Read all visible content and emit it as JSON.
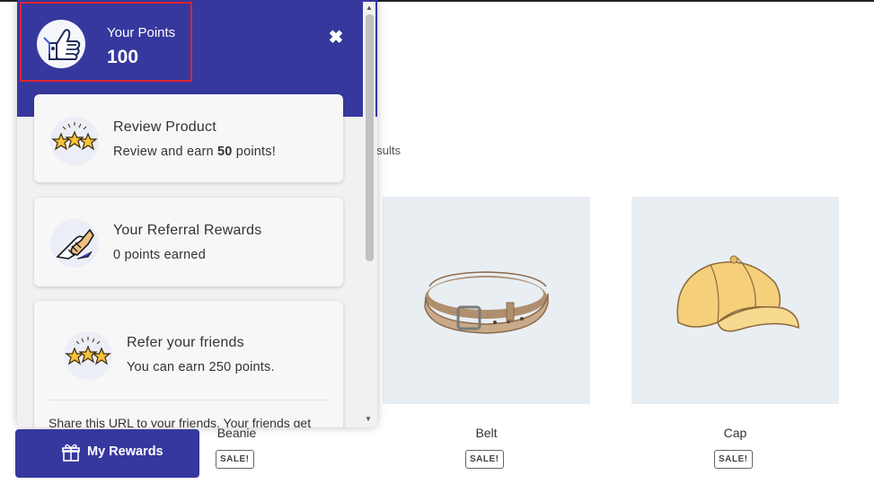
{
  "shop": {
    "results_text": "esults",
    "products": [
      {
        "name": "Beanie",
        "badge": "SALE!"
      },
      {
        "name": "Belt",
        "badge": "SALE!"
      },
      {
        "name": "Cap",
        "badge": "SALE!"
      }
    ]
  },
  "rewards_panel": {
    "points_label": "Your Points",
    "points_value": "100",
    "close_icon": "close-icon",
    "cards": [
      {
        "icon": "stars-icon",
        "title": "Review Product",
        "sub_prefix": "Review and earn ",
        "sub_bold": "50",
        "sub_suffix": " points!"
      },
      {
        "icon": "handshake-icon",
        "title": "Your Referral Rewards",
        "sub": "0 points earned"
      },
      {
        "icon": "stars-icon",
        "title": "Refer your friends",
        "sub": "You can earn 250 points.",
        "share_text": "Share this URL to your friends. Your friends get"
      }
    ]
  },
  "my_rewards_button": {
    "label": "My Rewards",
    "icon": "gift-icon"
  },
  "colors": {
    "brand": "#36389e",
    "highlight": "#e0222e",
    "product_bg": "#e9eef3"
  }
}
